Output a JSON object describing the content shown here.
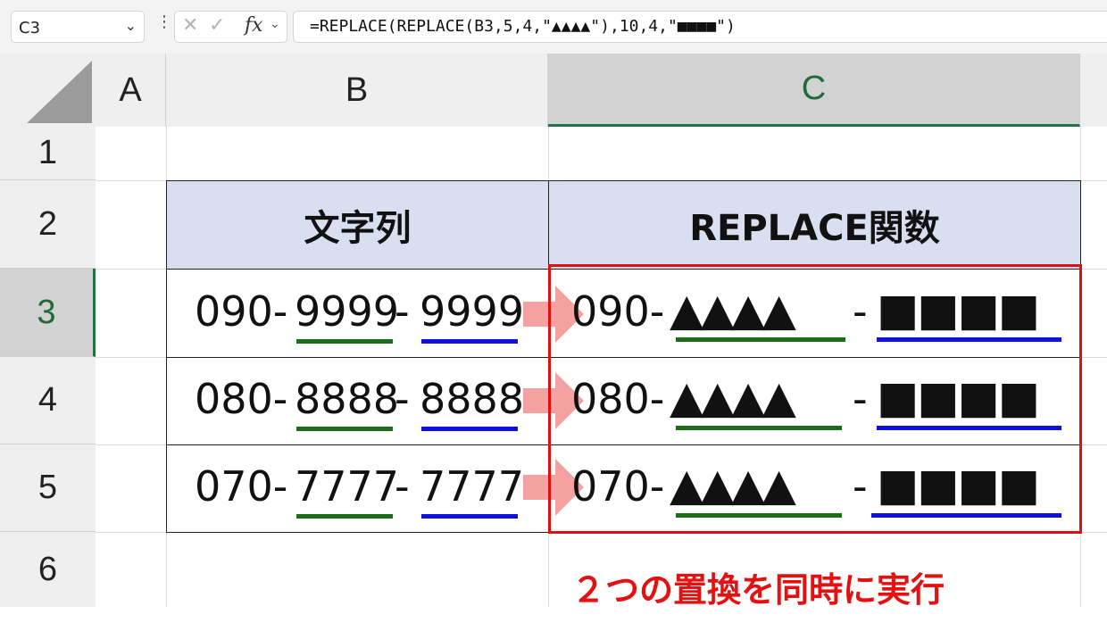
{
  "formula_bar": {
    "name_box": "C3",
    "formula": "=REPLACE(REPLACE(B3,5,4,\"▲▲▲▲\"),10,4,\"■■■■\")",
    "icons": [
      "cancel-icon",
      "enter-icon",
      "insert-function-icon"
    ]
  },
  "columns": [
    "A",
    "B",
    "C"
  ],
  "rows": [
    "1",
    "2",
    "3",
    "4",
    "5",
    "6"
  ],
  "selected": {
    "column": "C",
    "row": "3"
  },
  "table": {
    "header_b": "文字列",
    "header_c": "REPLACE関数",
    "rows": [
      {
        "b_prefix": "090-",
        "b_mid": "9999",
        "b_dash": "-",
        "b_last": "9999",
        "c_prefix": "090-",
        "c_mid": "▲▲▲▲",
        "c_dash": "-",
        "c_last": "■■■■"
      },
      {
        "b_prefix": "080-",
        "b_mid": "8888",
        "b_dash": "-",
        "b_last": "8888",
        "c_prefix": "080-",
        "c_mid": "▲▲▲▲",
        "c_dash": "-",
        "c_last": "■■■■"
      },
      {
        "b_prefix": "070-",
        "b_mid": "7777",
        "b_dash": "-",
        "b_last": "7777",
        "c_prefix": "070-",
        "c_mid": "▲▲▲▲",
        "c_dash": "-",
        "c_last": "■■■■"
      }
    ]
  },
  "annotation": "２つの置換を同時に実行",
  "colors": {
    "header_fill": "#d9dff0",
    "highlight_box": "#e01010",
    "underline_mid": "#1a6e1a",
    "underline_last": "#1010e0",
    "arrow": "#f4a1a1",
    "annotation_text": "#e51010"
  }
}
